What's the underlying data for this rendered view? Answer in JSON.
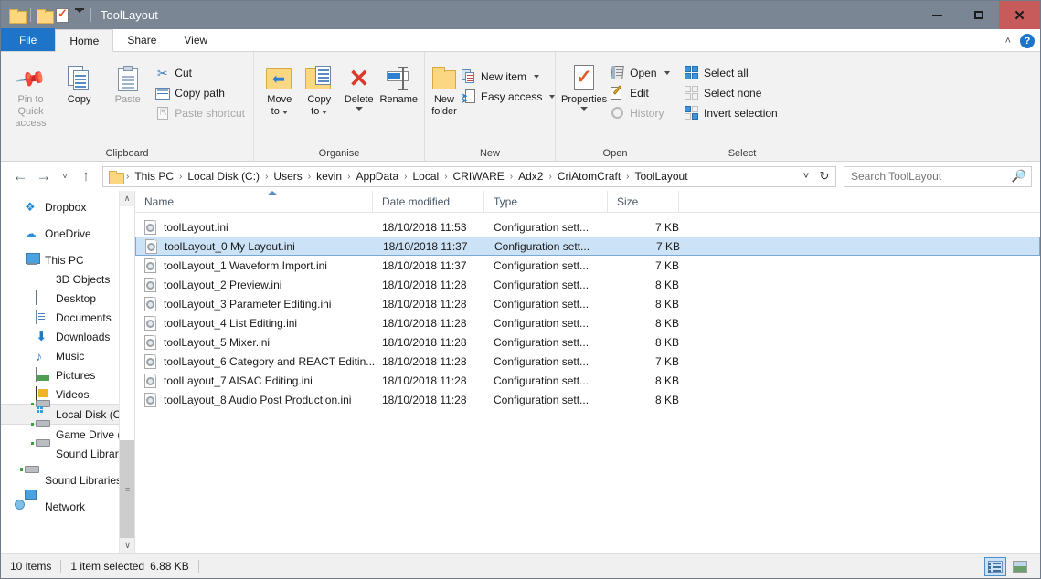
{
  "window": {
    "title": "ToolLayout",
    "quick_access": [
      "folder-icon",
      "folder-icon",
      "properties-icon",
      "customize-dropdown-icon"
    ],
    "controls": {
      "minimize": "–",
      "maximize": "□",
      "close": "✕"
    }
  },
  "tabs": [
    {
      "label": "File",
      "key": "file"
    },
    {
      "label": "Home",
      "key": "home"
    },
    {
      "label": "Share",
      "key": "share"
    },
    {
      "label": "View",
      "key": "view"
    }
  ],
  "tabrow_right": {
    "collapse": "˄",
    "help": "?"
  },
  "ribbon": {
    "groups": [
      {
        "label": "Clipboard",
        "big": [
          {
            "label_line1": "Pin to Quick",
            "label_line2": "access",
            "icon": "pin-icon",
            "dim": true
          },
          {
            "label_line1": "Copy",
            "label_line2": "",
            "icon": "copy-icon",
            "dim": false
          },
          {
            "label_line1": "Paste",
            "label_line2": "",
            "icon": "paste-icon",
            "dim": true
          }
        ],
        "small": [
          {
            "label": "Cut",
            "icon": "scissors-icon",
            "dim": false
          },
          {
            "label": "Copy path",
            "icon": "copy-path-icon",
            "dim": false
          },
          {
            "label": "Paste shortcut",
            "icon": "paste-shortcut-icon",
            "dim": true
          }
        ]
      },
      {
        "label": "Organise",
        "big": [
          {
            "label_line1": "Move",
            "label_line2": "to",
            "icon": "move-to-icon",
            "caret": true
          },
          {
            "label_line1": "Copy",
            "label_line2": "to",
            "icon": "copy-to-icon",
            "caret": true
          },
          {
            "label_line1": "Delete",
            "label_line2": "",
            "icon": "delete-icon",
            "caret": true
          },
          {
            "label_line1": "Rename",
            "label_line2": "",
            "icon": "rename-icon",
            "caret": false
          }
        ],
        "small": []
      },
      {
        "label": "New",
        "big": [
          {
            "label_line1": "New",
            "label_line2": "folder",
            "icon": "new-folder-icon",
            "caret": false
          }
        ],
        "small": [
          {
            "label": "New item",
            "icon": "new-item-icon",
            "caret": true
          },
          {
            "label": "Easy access",
            "icon": "easy-access-icon",
            "caret": true
          }
        ]
      },
      {
        "label": "Open",
        "big": [
          {
            "label_line1": "Properties",
            "label_line2": "",
            "icon": "properties-icon",
            "caret": true
          }
        ],
        "small": [
          {
            "label": "Open",
            "icon": "open-icon",
            "caret": true,
            "dim": false
          },
          {
            "label": "Edit",
            "icon": "edit-icon",
            "caret": false,
            "dim": false
          },
          {
            "label": "History",
            "icon": "history-icon",
            "caret": false,
            "dim": true
          }
        ]
      },
      {
        "label": "Select",
        "big": [],
        "small": [
          {
            "label": "Select all",
            "icon": "select-all-icon",
            "dim": false
          },
          {
            "label": "Select none",
            "icon": "select-none-icon",
            "dim": false
          },
          {
            "label": "Invert selection",
            "icon": "invert-selection-icon",
            "dim": false
          }
        ]
      }
    ]
  },
  "address": {
    "back": "←",
    "forward": "→",
    "recent": "˅",
    "up": "↑",
    "breadcrumbs": [
      "This PC",
      "Local Disk (C:)",
      "Users",
      "kevin",
      "AppData",
      "Local",
      "CRIWARE",
      "Adx2",
      "CriAtomCraft",
      "ToolLayout"
    ],
    "separator": "›",
    "dropdown": "˅",
    "refresh": "↻"
  },
  "search": {
    "placeholder": "Search ToolLayout",
    "value": "",
    "icon": "search-icon"
  },
  "navigation": {
    "items": [
      {
        "label": "Dropbox",
        "icon": "dropbox-icon",
        "indent": false,
        "selected": false,
        "spacer_before": false
      },
      {
        "label": "OneDrive",
        "icon": "onedrive-icon",
        "indent": false,
        "selected": false,
        "spacer_before": true
      },
      {
        "label": "This PC",
        "icon": "this-pc-icon",
        "indent": false,
        "selected": false,
        "spacer_before": true
      },
      {
        "label": "3D Objects",
        "icon": "3d-objects-icon",
        "indent": true,
        "selected": false,
        "spacer_before": false
      },
      {
        "label": "Desktop",
        "icon": "desktop-icon",
        "indent": true,
        "selected": false,
        "spacer_before": false
      },
      {
        "label": "Documents",
        "icon": "documents-icon",
        "indent": true,
        "selected": false,
        "spacer_before": false
      },
      {
        "label": "Downloads",
        "icon": "downloads-icon",
        "indent": true,
        "selected": false,
        "spacer_before": false
      },
      {
        "label": "Music",
        "icon": "music-icon",
        "indent": true,
        "selected": false,
        "spacer_before": false
      },
      {
        "label": "Pictures",
        "icon": "pictures-icon",
        "indent": true,
        "selected": false,
        "spacer_before": false
      },
      {
        "label": "Videos",
        "icon": "videos-icon",
        "indent": true,
        "selected": false,
        "spacer_before": false
      },
      {
        "label": "Local Disk (C:)",
        "icon": "drive-icon",
        "indent": true,
        "selected": true,
        "spacer_before": false
      },
      {
        "label": "Game Drive (D:)",
        "icon": "drive-icon",
        "indent": true,
        "selected": false,
        "spacer_before": false
      },
      {
        "label": "Sound Libraries W",
        "icon": "drive-icon",
        "indent": true,
        "selected": false,
        "spacer_before": false
      },
      {
        "label": "Sound Libraries Vo",
        "icon": "drive-icon",
        "indent": false,
        "selected": false,
        "spacer_before": true
      },
      {
        "label": "Network",
        "icon": "network-icon",
        "indent": false,
        "selected": false,
        "spacer_before": true
      }
    ]
  },
  "filelist": {
    "columns": [
      {
        "label": "Name",
        "key": "name",
        "sorted": "asc"
      },
      {
        "label": "Date modified",
        "key": "date"
      },
      {
        "label": "Type",
        "key": "type"
      },
      {
        "label": "Size",
        "key": "size"
      }
    ],
    "rows": [
      {
        "name": "toolLayout.ini",
        "date": "18/10/2018 11:53",
        "type": "Configuration sett...",
        "size": "7 KB",
        "selected": false
      },
      {
        "name": "toolLayout_0 My Layout.ini",
        "date": "18/10/2018 11:37",
        "type": "Configuration sett...",
        "size": "7 KB",
        "selected": true
      },
      {
        "name": "toolLayout_1 Waveform Import.ini",
        "date": "18/10/2018 11:37",
        "type": "Configuration sett...",
        "size": "7 KB",
        "selected": false
      },
      {
        "name": "toolLayout_2 Preview.ini",
        "date": "18/10/2018 11:28",
        "type": "Configuration sett...",
        "size": "8 KB",
        "selected": false
      },
      {
        "name": "toolLayout_3 Parameter Editing.ini",
        "date": "18/10/2018 11:28",
        "type": "Configuration sett...",
        "size": "8 KB",
        "selected": false
      },
      {
        "name": "toolLayout_4 List Editing.ini",
        "date": "18/10/2018 11:28",
        "type": "Configuration sett...",
        "size": "8 KB",
        "selected": false
      },
      {
        "name": "toolLayout_5 Mixer.ini",
        "date": "18/10/2018 11:28",
        "type": "Configuration sett...",
        "size": "8 KB",
        "selected": false
      },
      {
        "name": "toolLayout_6 Category and REACT Editin...",
        "date": "18/10/2018 11:28",
        "type": "Configuration sett...",
        "size": "7 KB",
        "selected": false
      },
      {
        "name": "toolLayout_7 AISAC Editing.ini",
        "date": "18/10/2018 11:28",
        "type": "Configuration sett...",
        "size": "8 KB",
        "selected": false
      },
      {
        "name": "toolLayout_8 Audio Post Production.ini",
        "date": "18/10/2018 11:28",
        "type": "Configuration sett...",
        "size": "8 KB",
        "selected": false
      }
    ]
  },
  "status": {
    "item_count": "10 items",
    "selection": "1 item selected",
    "selection_size": "6.88 KB",
    "views": [
      {
        "name": "details-view",
        "active": true
      },
      {
        "name": "large-icons-view",
        "active": false
      }
    ]
  },
  "colors": {
    "titlebar": "#7a8694",
    "file_tab": "#1e74c8",
    "selection": "#cce3f7",
    "selection_border": "#7aa9d6",
    "close_button": "#c75b5b",
    "ribbon_bg": "#f2f2f2"
  }
}
